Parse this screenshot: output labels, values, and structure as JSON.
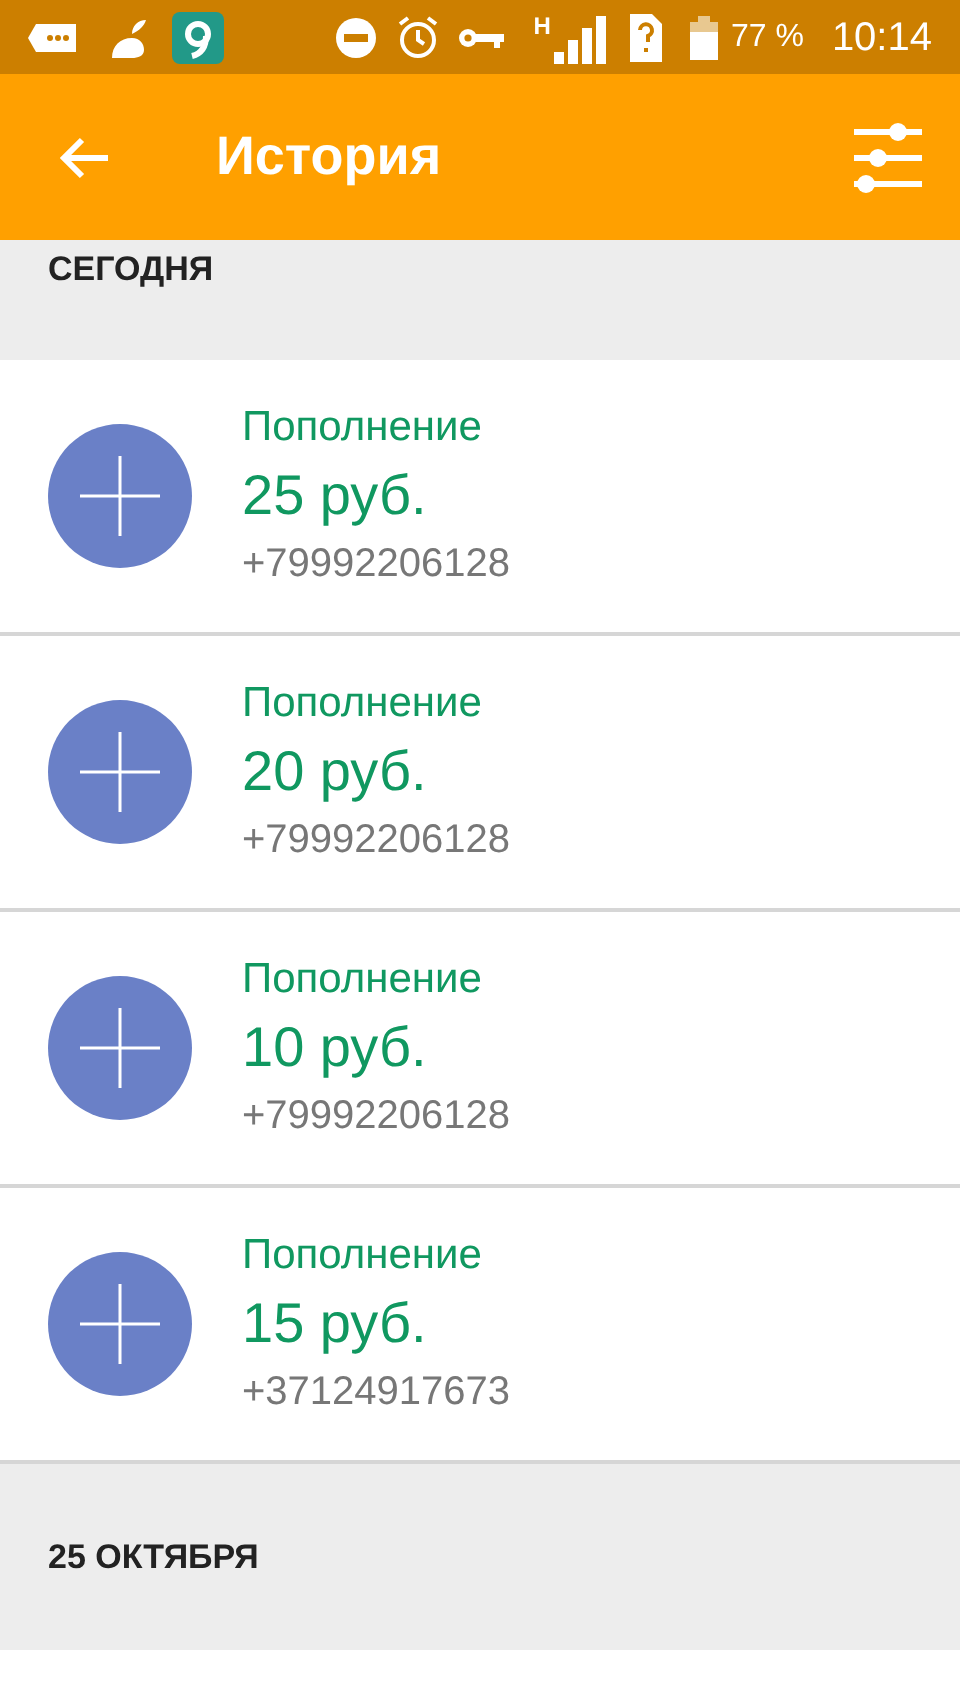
{
  "status_bar": {
    "network": "H",
    "battery": "77 %",
    "time": "10:14"
  },
  "app_bar": {
    "title": "История"
  },
  "sections": [
    {
      "header": "СЕГОДНЯ",
      "items": [
        {
          "kind": "topup",
          "title": "Пополнение",
          "amount": "25 руб.",
          "phone": "+79992206128"
        },
        {
          "kind": "topup",
          "title": "Пополнение",
          "amount": "20 руб.",
          "phone": "+79992206128"
        },
        {
          "kind": "topup",
          "title": "Пополнение",
          "amount": "10 руб.",
          "phone": "+79992206128"
        },
        {
          "kind": "topup",
          "title": "Пополнение",
          "amount": "15 руб.",
          "phone": "+37124917673"
        }
      ]
    },
    {
      "header": "25 ОКТЯБРЯ"
    }
  ]
}
